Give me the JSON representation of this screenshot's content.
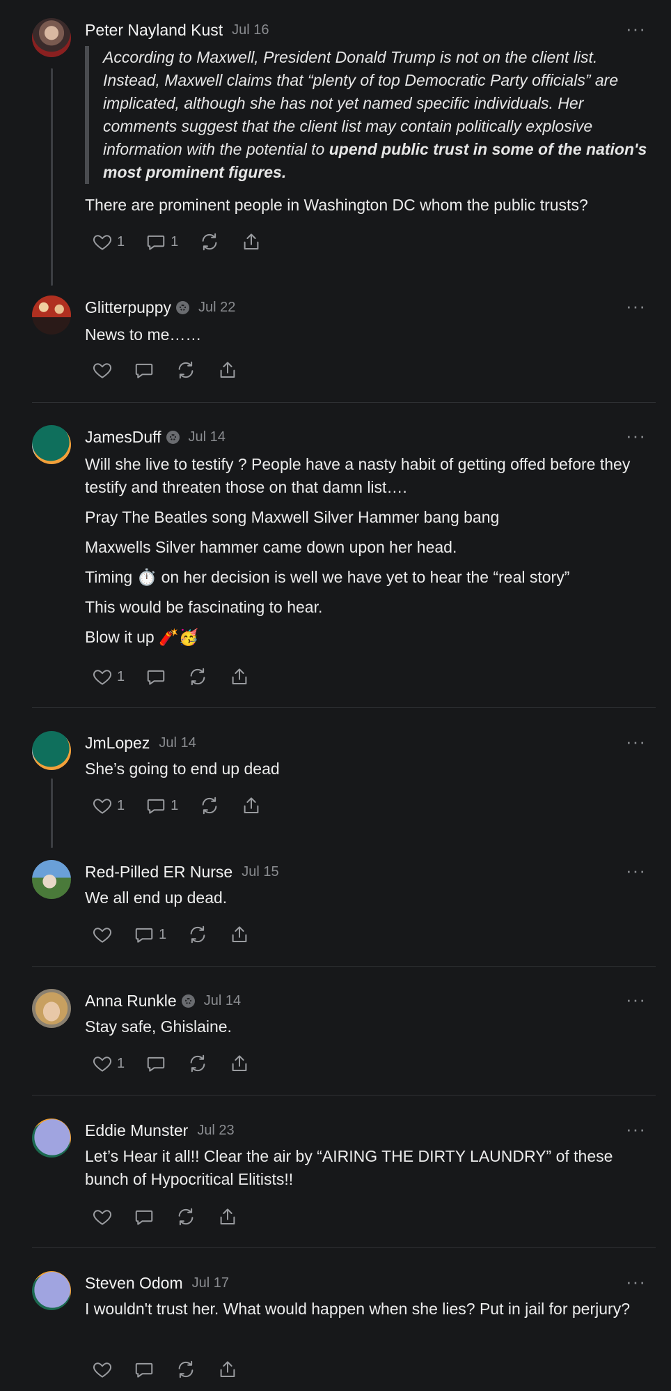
{
  "comments": [
    {
      "author": "Peter Nayland Kust",
      "date": "Jul 16",
      "quote_plain": "According to Maxwell, President Donald Trump is not on the client list. Instead, Maxwell claims that “plenty of top Democratic Party officials” are implicated, although she has not yet named specific individuals. Her comments suggest that the client list may contain politically explosive information with the potential to ",
      "quote_bold": "upend public trust in some of the nation's most prominent figures.",
      "text": "There are prominent people in Washington DC whom the public trusts?",
      "likes": "1",
      "replies": "1"
    },
    {
      "author": "Glitterpuppy",
      "date": "Jul 22",
      "text": "News to me……"
    },
    {
      "author": "JamesDuff",
      "date": "Jul 14",
      "paragraphs": [
        "Will she live to testify ? People have a nasty habit of getting offed before they testify and threaten those on that damn list….",
        "Pray The Beatles song Maxwell Silver Hammer bang bang",
        "Maxwells Silver hammer came down upon her head.",
        "Timing ⏱️ on her decision is well we have yet to hear the “real story”",
        "This would be fascinating to hear.",
        "Blow it up 🧨🥳"
      ],
      "likes": "1"
    },
    {
      "author": "JmLopez",
      "date": "Jul 14",
      "text": "She’s going to end up dead",
      "likes": "1",
      "replies": "1"
    },
    {
      "author": "Red-Pilled ER Nurse",
      "date": "Jul 15",
      "text": "We all end up dead.",
      "replies": "1"
    },
    {
      "author": "Anna Runkle",
      "date": "Jul 14",
      "text": "Stay safe, Ghislaine.",
      "likes": "1"
    },
    {
      "author": "Eddie Munster",
      "date": "Jul 23",
      "text": "Let’s Hear it all!! Clear the air by “AIRING THE DIRTY LAUNDRY” of these bunch of Hypocritical Elitists!!"
    },
    {
      "author": "Steven Odom",
      "date": "Jul 17",
      "text": "I wouldn't trust her. What would happen when she lies? Put in jail for perjury?"
    }
  ],
  "more_label": "···",
  "colors": {
    "background": "#17181a",
    "text": "#ececec",
    "muted": "#8a8c90"
  },
  "icons": [
    "heart-icon",
    "comment-icon",
    "restack-icon",
    "share-icon",
    "more-icon",
    "verified-badge-icon"
  ]
}
